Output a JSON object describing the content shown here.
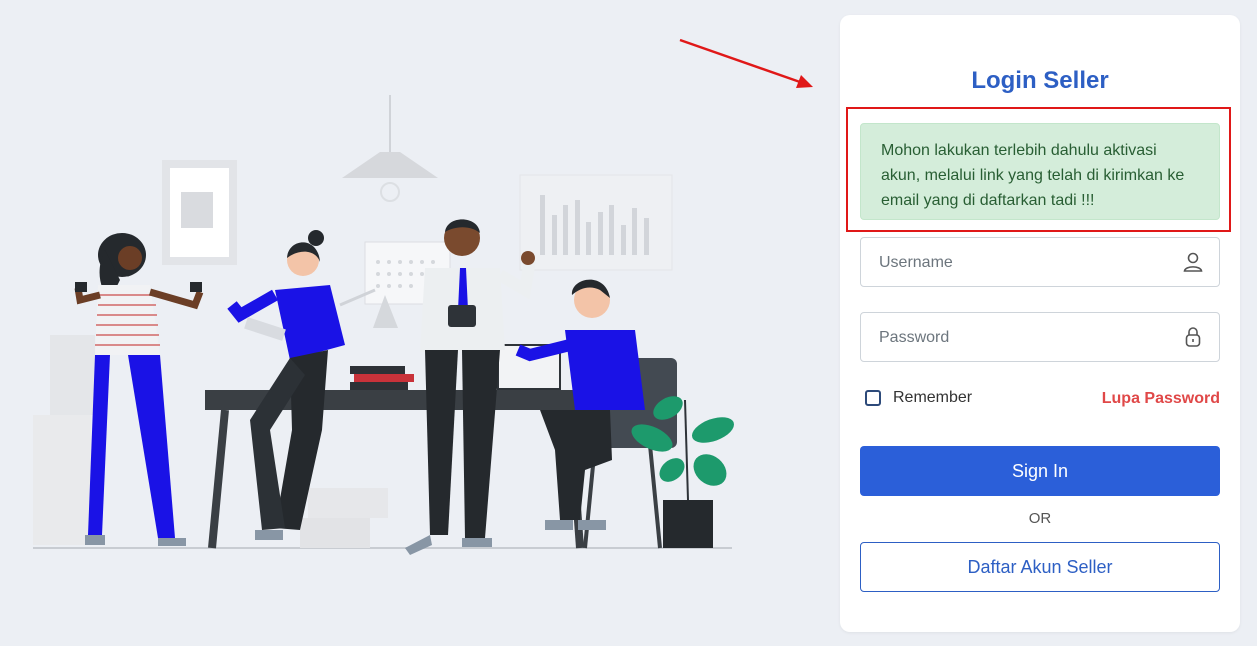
{
  "login": {
    "title": "Login Seller",
    "alert_message": "Mohon lakukan terlebih dahulu aktivasi akun, melalui link yang telah di kirimkan ke email yang di daftarkan tadi !!!",
    "username_placeholder": "Username",
    "password_placeholder": "Password",
    "remember_label": "Remember",
    "forgot_label": "Lupa Password",
    "signin_label": "Sign In",
    "or_label": "OR",
    "register_label": "Daftar Akun Seller"
  },
  "icons": {
    "username_icon": "user-icon",
    "password_icon": "lock-icon"
  },
  "colors": {
    "accent": "#2b5fd9",
    "title": "#2d5fc4",
    "alert_bg": "#d4edda",
    "alert_text": "#285e33",
    "danger": "#e04848",
    "annotation_red": "#e01818",
    "figure_blue": "#1a12e6",
    "background": "#eceff4"
  }
}
